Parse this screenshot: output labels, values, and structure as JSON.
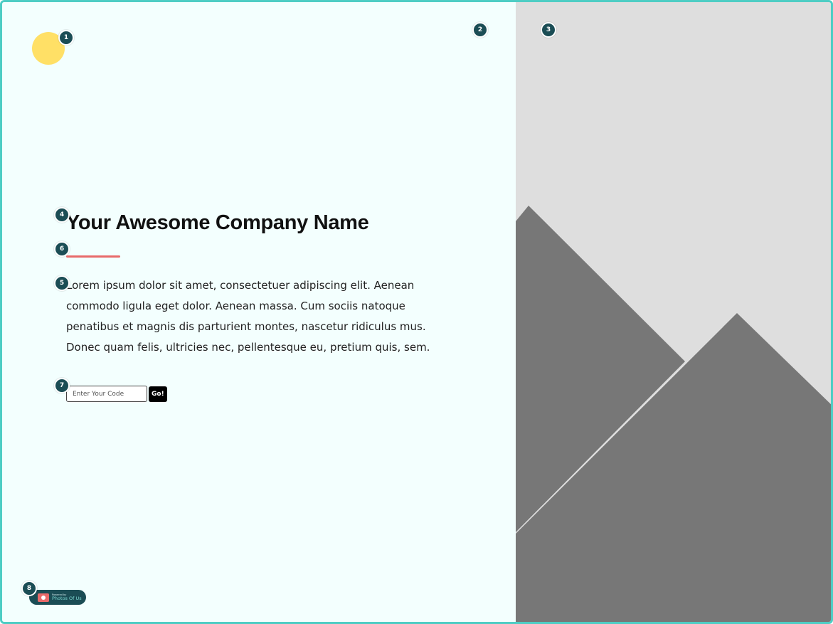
{
  "hero": {
    "title": "Your Awesome Company Name",
    "body": "Lorem ipsum dolor sit amet, consectetuer adipiscing elit. Aenean commodo ligula eget dolor. Aenean massa. Cum sociis natoque penatibus et magnis dis parturient montes, nascetur ridiculus mus. Donec quam felis, ultricies nec, pellentesque eu, pretium quis, sem."
  },
  "code_form": {
    "placeholder": "Enter Your Code",
    "value": "",
    "submit_label": "Go!"
  },
  "badge": {
    "caption": "Powered by",
    "name": "Photos Of Us"
  },
  "markers": [
    "1",
    "2",
    "3",
    "4",
    "5",
    "6",
    "7",
    "8"
  ],
  "colors": {
    "frame_border": "#4ecdc4",
    "page_background": "#f3fffe",
    "logo_yellow": "#ffe066",
    "accent_red": "#e86a6a",
    "marker_teal": "#1b4d55",
    "image_placeholder_bg": "#dedede",
    "image_placeholder_mountain": "#777777"
  },
  "icons": {
    "logo": "circle-logo-icon",
    "placeholder": "mountain-image-placeholder-icon",
    "badge": "camera-icon"
  }
}
